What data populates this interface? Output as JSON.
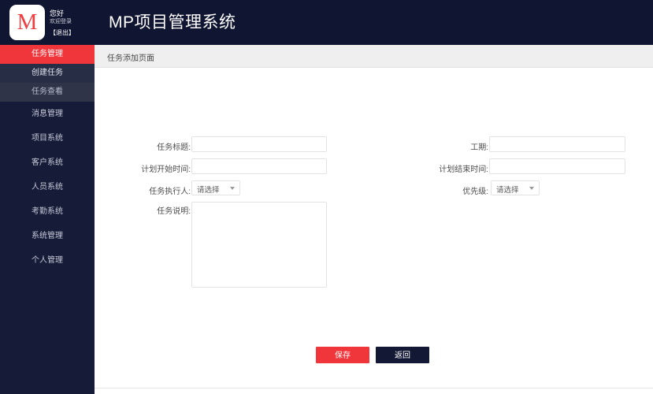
{
  "header": {
    "logo_letter": "M",
    "greeting": "您好",
    "greeting_sub": "欢迎登录",
    "logout": "【退出】",
    "title": "MP项目管理系统"
  },
  "sidebar": {
    "items": [
      {
        "label": "任务管理",
        "state": "active"
      },
      {
        "label": "创建任务",
        "state": "sub"
      },
      {
        "label": "任务查看",
        "state": "sub-current"
      },
      {
        "label": "消息管理",
        "state": "plain"
      },
      {
        "label": "项目系统",
        "state": "plain"
      },
      {
        "label": "客户系统",
        "state": "plain"
      },
      {
        "label": "人员系统",
        "state": "plain"
      },
      {
        "label": "考勤系统",
        "state": "plain"
      },
      {
        "label": "系统管理",
        "state": "plain"
      },
      {
        "label": "个人管理",
        "state": "plain"
      }
    ]
  },
  "breadcrumb": {
    "text": "任务添加页面"
  },
  "form": {
    "task_title": {
      "label": "任务标题:",
      "value": "",
      "placeholder": ""
    },
    "duration": {
      "label": "工期:",
      "value": "",
      "placeholder": ""
    },
    "plan_start": {
      "label": "计划开始时间:",
      "value": "",
      "placeholder": ""
    },
    "plan_end": {
      "label": "计划结束时间:",
      "value": "",
      "placeholder": ""
    },
    "executor": {
      "label": "任务执行人:",
      "selected": "请选择"
    },
    "priority": {
      "label": "优先级:",
      "selected": "请选择"
    },
    "description": {
      "label": "任务说明:",
      "value": "",
      "placeholder": ""
    }
  },
  "buttons": {
    "save": "保存",
    "back": "返回"
  },
  "colors": {
    "header_bg": "#101531",
    "sidebar_bg": "#161b38",
    "accent_red": "#f0353b",
    "crumb_bg": "#efefef",
    "dark_button": "#131834"
  }
}
